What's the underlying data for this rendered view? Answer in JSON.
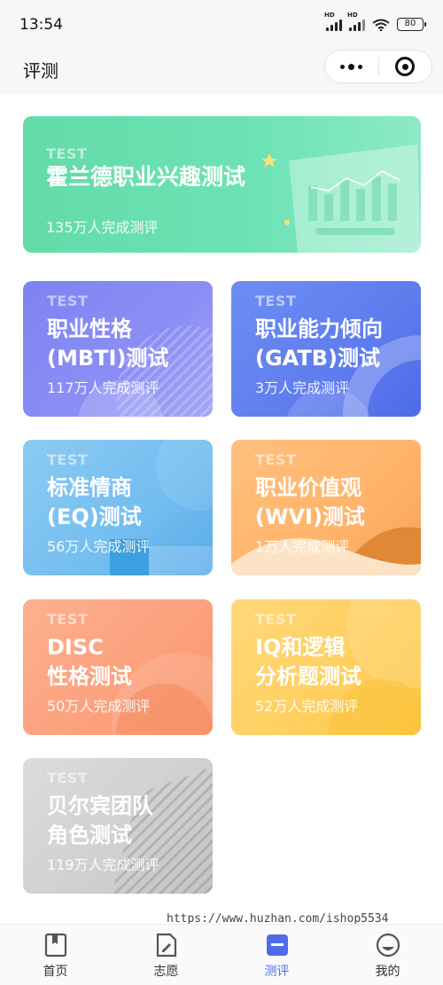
{
  "status_bar": {
    "time": "13:54",
    "signal_1": "HD",
    "signal_2": "HD",
    "battery": "80"
  },
  "nav": {
    "title": "评测",
    "icons": [
      "more-dots-icon",
      "close-target-icon"
    ]
  },
  "cards": [
    {
      "id": "holland",
      "tag": "TEST",
      "title_lines": [
        "霍兰德职业兴趣测试"
      ],
      "count": "135万人完成测评",
      "color": "#63dba8"
    },
    {
      "id": "mbti",
      "tag": "TEST",
      "title_lines": [
        "职业性格",
        "(MBTI)测试"
      ],
      "count": "117万人完成测评",
      "color": "#8489f3"
    },
    {
      "id": "gatb",
      "tag": "TEST",
      "title_lines": [
        "职业能力倾向",
        "(GATB)测试"
      ],
      "count": "3万人完成测评",
      "color": "#5f7cee"
    },
    {
      "id": "eq",
      "tag": "TEST",
      "title_lines": [
        "标准情商",
        "(EQ)测试"
      ],
      "count": "56万人完成测评",
      "color": "#73bdf0"
    },
    {
      "id": "wvi",
      "tag": "TEST",
      "title_lines": [
        "职业价值观",
        "(WVI)测试"
      ],
      "count": "1万人完成测评",
      "color": "#ffb36a"
    },
    {
      "id": "disc",
      "tag": "TEST",
      "title_lines": [
        "DISC",
        "性格测试"
      ],
      "count": "50万人完成测评",
      "color": "#fca07c"
    },
    {
      "id": "iq",
      "tag": "TEST",
      "title_lines": [
        "IQ和逻辑",
        "分析题测试"
      ],
      "count": "52万人完成测评",
      "color": "#ffcf5e"
    },
    {
      "id": "belbin",
      "tag": "TEST",
      "title_lines": [
        "贝尔宾团队",
        "角色测试"
      ],
      "count": "119万人完成测评",
      "color": "#cfcfcf"
    }
  ],
  "watermark": "https://www.huzhan.com/ishop5534",
  "tabs": [
    {
      "label": "首页",
      "icon": "book-icon",
      "active": false
    },
    {
      "label": "志愿",
      "icon": "edit-document-icon",
      "active": false
    },
    {
      "label": "测评",
      "icon": "assessment-icon",
      "active": true
    },
    {
      "label": "我的",
      "icon": "profile-face-icon",
      "active": false
    }
  ],
  "colors": {
    "accent": "#4f6ce8",
    "nav_bg": "#f6f7f9"
  }
}
